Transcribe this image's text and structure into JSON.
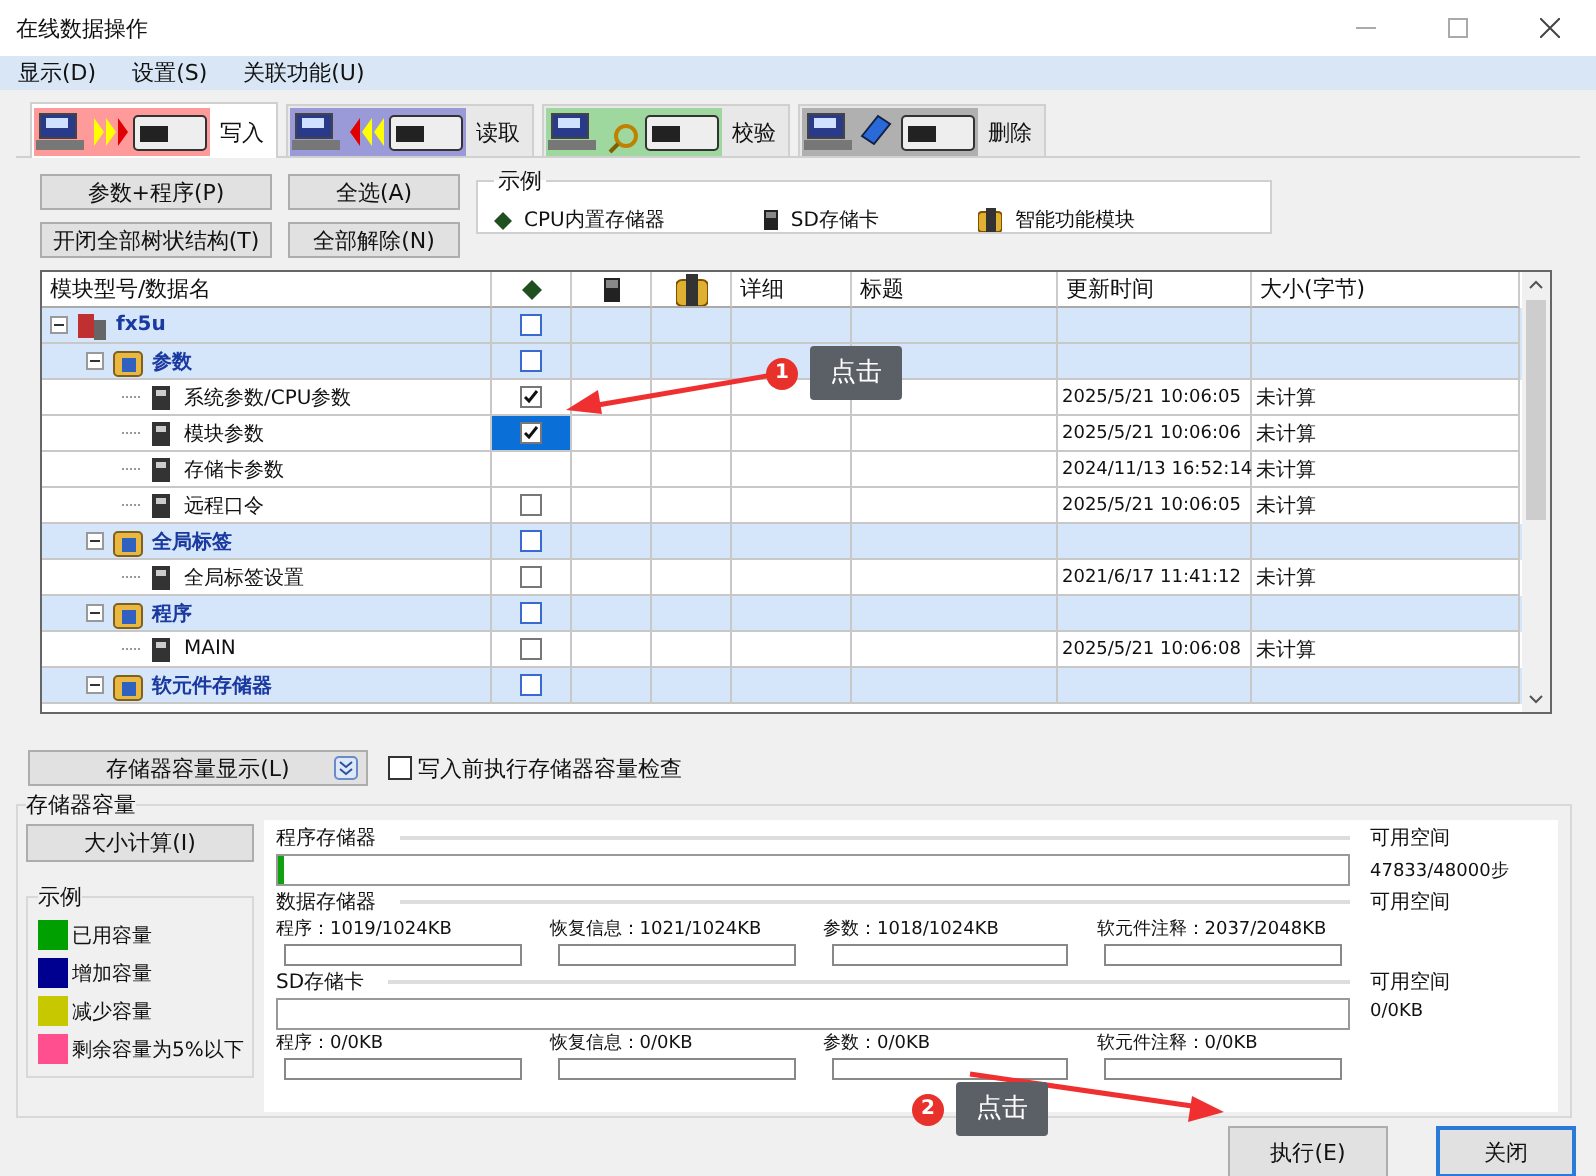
{
  "window": {
    "title": "在线数据操作"
  },
  "menu": [
    "显示(D)",
    "设置(S)",
    "关联功能(U)"
  ],
  "tabs": [
    {
      "label": "写入",
      "kind": "write",
      "selected": true
    },
    {
      "label": "读取",
      "kind": "read",
      "selected": false
    },
    {
      "label": "校验",
      "kind": "verify",
      "selected": false
    },
    {
      "label": "删除",
      "kind": "delete",
      "selected": false
    }
  ],
  "actions": [
    [
      "参数+程序(P)",
      "全选(A)"
    ],
    [
      "开闭全部树状结构(T)",
      "全部解除(N)"
    ]
  ],
  "legend": {
    "title": "示例",
    "items": [
      {
        "kind": "cpu",
        "label": "CPU内置存储器"
      },
      {
        "kind": "sd",
        "label": "SD存储卡"
      },
      {
        "kind": "module",
        "label": "智能功能模块"
      }
    ]
  },
  "table": {
    "columns": [
      {
        "kind": "text",
        "label": "模块型号/数据名"
      },
      {
        "kind": "cpu"
      },
      {
        "kind": "sd"
      },
      {
        "kind": "module"
      },
      {
        "kind": "text",
        "label": "详细"
      },
      {
        "kind": "text",
        "label": "标题"
      },
      {
        "kind": "text",
        "label": "更新时间"
      },
      {
        "kind": "text",
        "label": "大小(字节)"
      }
    ],
    "rows": [
      {
        "name": "fx5u",
        "kind": "root",
        "expanded": true,
        "checked": false,
        "selected": false,
        "children": [
          {
            "name": "参数",
            "kind": "group",
            "expanded": true,
            "checked": false,
            "selected": false,
            "children": [
              {
                "name": "系统参数/CPU参数",
                "kind": "item",
                "checked": true,
                "selected": false,
                "updated": "2025/5/21 10:06:05",
                "size": "未计算"
              },
              {
                "name": "模块参数",
                "kind": "item",
                "checked": true,
                "selected": true,
                "updated": "2025/5/21 10:06:06",
                "size": "未计算"
              },
              {
                "name": "存储卡参数",
                "kind": "item",
                "selected": false,
                "updated": "2024/11/13 16:52:14",
                "size": "未计算"
              },
              {
                "name": "远程口令",
                "kind": "item",
                "checked": false,
                "selected": false,
                "updated": "2025/5/21 10:06:05",
                "size": "未计算"
              }
            ]
          },
          {
            "name": "全局标签",
            "kind": "group",
            "expanded": true,
            "checked": false,
            "selected": false,
            "children": [
              {
                "name": "全局标签设置",
                "kind": "item",
                "checked": false,
                "selected": false,
                "updated": "2021/6/17 11:41:12",
                "size": "未计算"
              }
            ]
          },
          {
            "name": "程序",
            "kind": "group",
            "expanded": true,
            "checked": false,
            "selected": false,
            "children": [
              {
                "name": "MAIN",
                "kind": "item",
                "checked": false,
                "selected": false,
                "updated": "2025/5/21 10:06:08",
                "size": "未计算"
              }
            ]
          },
          {
            "name": "软元件存储器",
            "kind": "group",
            "expanded": true,
            "checked": false,
            "selected": false
          }
        ]
      }
    ]
  },
  "capacity": {
    "toggle_button": "存储器容量显示(L)",
    "check_before_write": {
      "label": "写入前执行存储器容量检查",
      "checked": false
    },
    "title": "存储器容量",
    "calc_button": "大小计算(I)",
    "legend": {
      "title": "示例",
      "items": [
        {
          "label": "已用容量",
          "color": "#00a000"
        },
        {
          "label": "增加容量",
          "color": "#000090"
        },
        {
          "label": "减少容量",
          "color": "#c8c800"
        },
        {
          "label": "剩余容量为5%以下",
          "color": "#ff4f8f"
        }
      ]
    },
    "sections": [
      {
        "title": "程序存储器",
        "kind": "bar",
        "level": 0.005,
        "free_label": "可用空间",
        "free_value": "47833/48000步"
      },
      {
        "title": "数据存储器",
        "kind": "split",
        "free_label": "可用空间",
        "parts": [
          "程序：1019/1024KB",
          "恢复信息：1021/1024KB",
          "参数：1018/1024KB",
          "软元件注释：2037/2048KB"
        ]
      },
      {
        "title": "SD存储卡",
        "kind": "bar",
        "free_label": "可用空间",
        "free_value": "0/0KB",
        "parts": [
          "程序：0/0KB",
          "恢复信息：0/0KB",
          "参数：0/0KB",
          "软元件注释：0/0KB"
        ]
      }
    ]
  },
  "footer": [
    {
      "label": "执行(E)",
      "focused": false
    },
    {
      "label": "关闭",
      "focused": true
    }
  ],
  "callouts": [
    {
      "number": "1",
      "text": "点击"
    },
    {
      "number": "2",
      "text": "点击"
    }
  ]
}
